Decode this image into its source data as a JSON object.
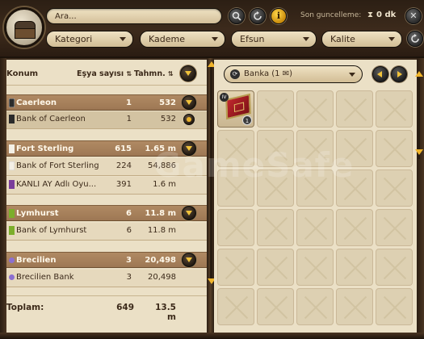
{
  "header": {
    "search": {
      "placeholder": "Ara..."
    },
    "last_update_label": "Son guncelleme:",
    "last_update_value": "0 dk",
    "filters": [
      {
        "label": "Kategori"
      },
      {
        "label": "Kademe"
      },
      {
        "label": "Efsun"
      },
      {
        "label": "Kalite"
      }
    ]
  },
  "table": {
    "columns": {
      "location": "Konum",
      "count": "Eşya sayısı",
      "estimate": "Tahmn."
    },
    "groups": [
      {
        "name": "Caerleon",
        "count": "1",
        "estimate": "532",
        "flag_color": "#2b2b2b",
        "rows": [
          {
            "name": "Bank of Caerleon",
            "count": "1",
            "estimate": "532",
            "flag_color": "#2b2b2b"
          }
        ]
      },
      {
        "name": "Fort Sterling",
        "count": "615",
        "estimate": "1.65 m",
        "flag_color": "#f4f0e6",
        "rows": [
          {
            "name": "Bank of Fort Sterling",
            "count": "224",
            "estimate": "54,886",
            "flag_color": "#f4f0e6"
          },
          {
            "name": "KANLI AY Adlı Oyu...",
            "count": "391",
            "estimate": "1.6 m",
            "flag_color": "#7a3d9b"
          }
        ]
      },
      {
        "name": "Lymhurst",
        "count": "6",
        "estimate": "11.8 m",
        "flag_color": "#7cae2b",
        "rows": [
          {
            "name": "Bank of Lymhurst",
            "count": "6",
            "estimate": "11.8 m",
            "flag_color": "#7cae2b"
          }
        ]
      },
      {
        "name": "Brecilien",
        "count": "3",
        "estimate": "20,498",
        "flag_color": "#8c6fd0",
        "rows": [
          {
            "name": "Brecilien Bank",
            "count": "3",
            "estimate": "20,498",
            "flag_color": "#8c6fd0"
          }
        ]
      }
    ],
    "total": {
      "label": "Toplam:",
      "count": "649",
      "estimate": "13.5 m"
    }
  },
  "bank_panel": {
    "selected": "Banka (1 ✉)",
    "item": {
      "tier": "IV",
      "quantity": "1"
    }
  },
  "watermark": "GameSafe"
}
